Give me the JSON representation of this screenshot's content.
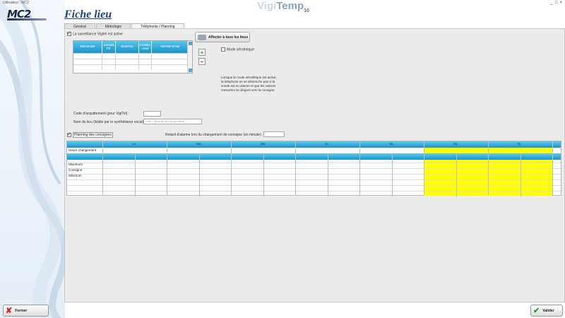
{
  "top": {
    "user": "Utilisateur : MC2",
    "window_controls": [
      "_",
      "□",
      "×"
    ]
  },
  "logo": {
    "text": "MC2"
  },
  "page_title": "Fiche lieu",
  "brand": {
    "part1": "Vigi",
    "part2": "Temp",
    "version": "10"
  },
  "tabs": [
    {
      "label": "Général",
      "active": false
    },
    {
      "label": "Métrologie",
      "active": false
    },
    {
      "label": "Téléphonie / Planning",
      "active": true
    }
  ],
  "surveillance": {
    "label": "La surveillance Vigitel est active",
    "checked": true
  },
  "contacts_table": {
    "columns": [
      "Intervenant",
      "Contact Tél.",
      "Numéros",
      "Contact email",
      "Adresse Email"
    ],
    "rows": [
      [
        "",
        "",
        "",
        "",
        ""
      ],
      [
        "",
        "",
        "",
        "",
        ""
      ],
      [
        "",
        "",
        "",
        "",
        ""
      ]
    ]
  },
  "assign_button": "Affecter à tous les lieux",
  "add_button": "+",
  "remove_button": "−",
  "serotheque": {
    "label": "Mode sérothèque",
    "checked": false
  },
  "serotheque_note": "Lorsque le mode sérothèque est activé, la téléphone ne se déclenche pas si la sonde est en alarme et que les valeurs mesurées se dirigent vers la consigne.",
  "ack_code": {
    "label": "Code d'acquittement (pour VigiTel) :",
    "value": ""
  },
  "place_name": {
    "label": "Nom du lieu (lisible par le synthétiseur vocal) :",
    "placeholder": "Vide = Nom du lieu lu par lettre"
  },
  "planning": {
    "label": "Planning des consignes",
    "checked": true
  },
  "delay": {
    "label": "Retard d'alarme lors du changement de consigne  (en minute) :",
    "value": ""
  },
  "grid": {
    "days": [
      "Lu.",
      "Ma.",
      "Me.",
      "Je.",
      "Ve.",
      "Sa.",
      "Di."
    ],
    "heure_label": "Heure changement",
    "rows": [
      "Maximum",
      "Consigne",
      "Minimum"
    ],
    "highlight_color": "#ffff00"
  },
  "footer": {
    "close": "Fermer",
    "validate": "Valider"
  }
}
